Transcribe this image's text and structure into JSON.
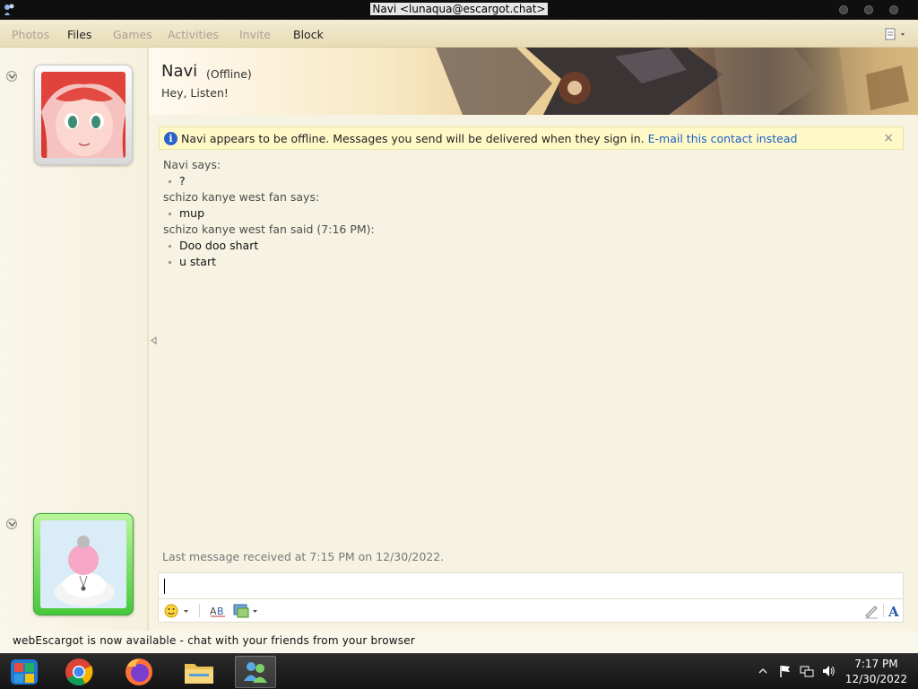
{
  "window": {
    "title": "Navi <lunaqua@escargot.chat>"
  },
  "menu": {
    "items": [
      {
        "label": "Photos",
        "enabled": false
      },
      {
        "label": "Files",
        "enabled": true
      },
      {
        "label": "Games",
        "enabled": false
      },
      {
        "label": "Activities",
        "enabled": false
      },
      {
        "label": "Invite",
        "enabled": false
      },
      {
        "label": "Block",
        "enabled": true
      }
    ]
  },
  "contact": {
    "name": "Navi",
    "status": "(Offline)",
    "personal_message": "Hey, Listen!"
  },
  "infobar": {
    "text": "Navi appears to be offline. Messages you send will be delivered when they sign in.",
    "link": "E-mail this contact instead",
    "close": "×"
  },
  "conversation": [
    {
      "header": "Navi says:",
      "messages": [
        "?"
      ]
    },
    {
      "header": "schizo kanye west fan says:",
      "messages": [
        "mup"
      ]
    },
    {
      "header": "schizo kanye west fan said (7:16 PM):",
      "messages": [
        "Doo doo shart",
        "u start"
      ]
    }
  ],
  "last_message": "Last message received at 7:15 PM on 12/30/2022.",
  "input": {
    "value": ""
  },
  "footer": {
    "news": "webEscargot is now available - chat with your friends from your browser"
  },
  "taskbar": {
    "apps": [
      "start-button",
      "chrome",
      "firefox",
      "file-explorer",
      "escargot-messenger"
    ],
    "clock_time": "7:17 PM",
    "clock_date": "12/30/2022"
  },
  "colors": {
    "accent_link": "#1a5ec7",
    "infobar_bg": "#fff9c8",
    "self_frame": "#47c83b",
    "taskbar": "#141414"
  }
}
